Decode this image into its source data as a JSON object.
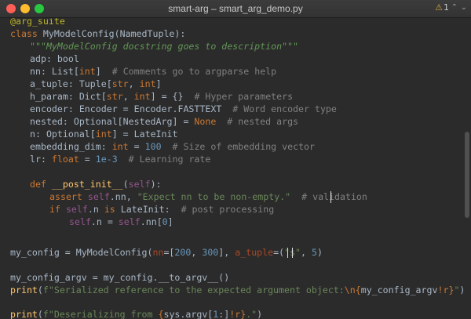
{
  "window": {
    "title": "smart-arg – smart_arg_demo.py",
    "warning_count": "1",
    "warning_icon": "warning-triangle-icon"
  },
  "code": {
    "l01": "@arg_suite",
    "l02a": "class ",
    "l02b": "MyModelConfig(NamedTuple):",
    "l03": "\"\"\"MyModelConfig docstring goes to description\"\"\"",
    "l04": "adp: bool",
    "l05a": "nn: List[",
    "l05b": "int",
    "l05c": "]  ",
    "l05d": "# Comments go to argparse help",
    "l06a": "a_tuple: Tuple[",
    "l06b": "str",
    "l06c": ", ",
    "l06d": "int",
    "l06e": "]",
    "l07a": "h_param: Dict[",
    "l07b": "str",
    "l07c": ", ",
    "l07d": "int",
    "l07e": "] = {}  ",
    "l07f": "# Hyper parameters",
    "l08a": "encoder: Encoder = Encoder.FASTTEXT  ",
    "l08b": "# Word encoder type",
    "l09a": "nested: Optional[NestedArg] = ",
    "l09b": "None",
    "l09c": "  ",
    "l09d": "# nested args",
    "l10a": "n: Optional[",
    "l10b": "int",
    "l10c": "] = LateInit",
    "l11a": "embedding_dim: ",
    "l11b": "int",
    "l11c": " = ",
    "l11d": "100",
    "l11e": "  ",
    "l11f": "# Size of embedding vector",
    "l12a": "lr: ",
    "l12b": "float",
    "l12c": " = ",
    "l12d": "1e-3",
    "l12e": "  ",
    "l12f": "# Learning rate",
    "l13a": "def ",
    "l13b": "__post_init__",
    "l13c": "(",
    "l13d": "self",
    "l13e": "):",
    "l14a": "assert ",
    "l14b": "self",
    "l14c": ".nn, ",
    "l14d": "\"Expect nn to be non-empty.\"",
    "l14e": "  ",
    "l14f": "# validation",
    "l15a": "if ",
    "l15b": "self",
    "l15c": ".n ",
    "l15d": "is ",
    "l15e": "LateInit:  ",
    "l15f": "# post processing",
    "l16a": "self",
    "l16b": ".n = ",
    "l16c": "self",
    "l16d": ".nn[",
    "l16e": "0",
    "l16f": "]",
    "l17a": "my_config = MyModelConfig(",
    "l17b": "nn",
    "l17c": "=[",
    "l17d": "200",
    "l17e": ", ",
    "l17f": "300",
    "l17g": "], ",
    "l17h": "a_tuple",
    "l17i": "=(",
    "l17j": "\"s\"",
    "l17k": ", ",
    "l17l": "5",
    "l17m": ")",
    "l18": "my_config_argv = my_config.__to_argv__()",
    "l19a": "print",
    "l19b": "(",
    "l19c": "f\"Serialized reference to the expected argument object:",
    "l19d": "\\n",
    "l19e": "{",
    "l19f": "my_config_argv",
    "l19g": "!r}",
    "l19h": "\"",
    "l19i": ")",
    "l20a": "print",
    "l20b": "(",
    "l20c": "f\"Deserializing from ",
    "l20d": "{",
    "l20e": "sys.argv[",
    "l20f": "1",
    "l20g": ":]",
    "l20h": "!r}",
    "l20i": ".\"",
    "l20j": ")"
  },
  "colors": {
    "background": "#2b2b2b",
    "keyword": "#cc7832",
    "string": "#6a8759",
    "comment": "#808080",
    "number": "#6897bb",
    "self": "#94558d",
    "function": "#ffc66d",
    "decorator": "#bbb529"
  }
}
